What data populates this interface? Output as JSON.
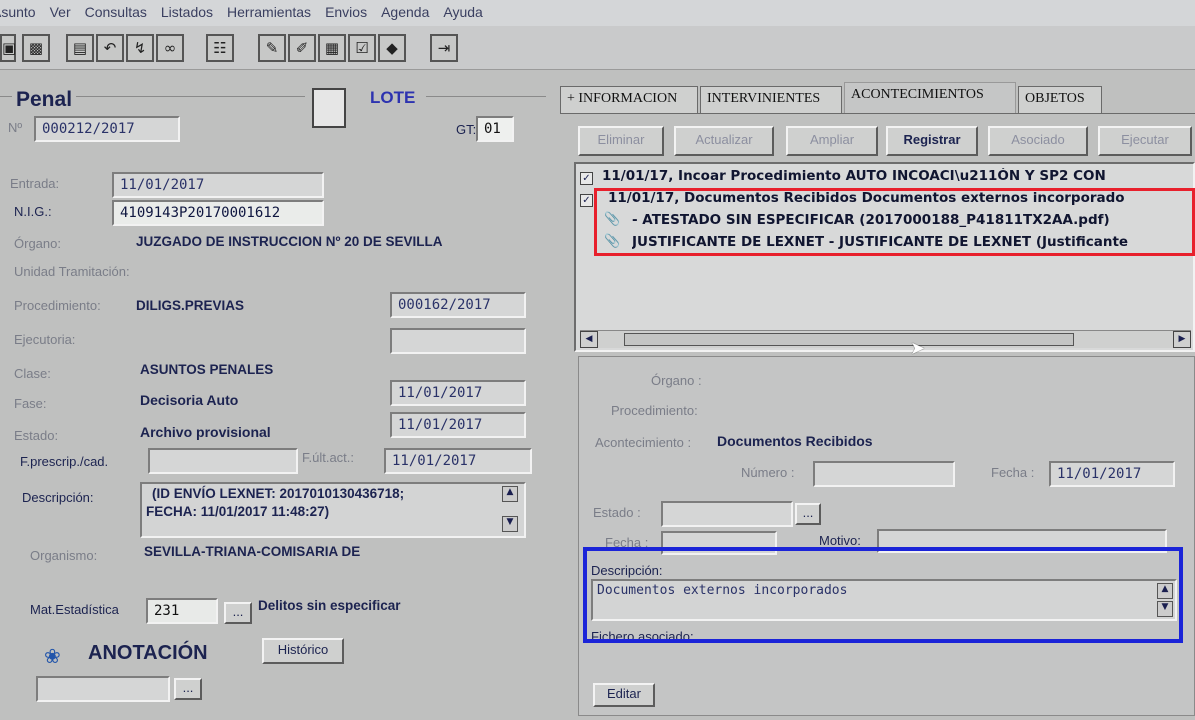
{
  "menu": [
    "Asunto",
    "Ver",
    "Consultas",
    "Listados",
    "Herramientas",
    "Envios",
    "Agenda",
    "Ayuda"
  ],
  "left": {
    "title": "Penal",
    "lote": "LOTE",
    "numero_label": "Nº",
    "numero": "000212/2017",
    "gt_label": "GT:",
    "gt": "01",
    "entrada_label": "Entrada:",
    "entrada": "11/01/2017",
    "nig_label": "N.I.G.:",
    "nig": "4109143P20170001612",
    "organo_label": "Órgano:",
    "organo": "JUZGADO DE INSTRUCCION Nº 20 DE SEVILLA",
    "unidad_label": "Unidad Tramitación:",
    "procedimiento_label": "Procedimiento:",
    "procedimiento": "DILIGS.PREVIAS",
    "procedimiento_num": "000162/2017",
    "ejecutoria_label": "Ejecutoria:",
    "clase_label": "Clase:",
    "clase": "ASUNTOS PENALES",
    "fase_label": "Fase:",
    "fase": "Decisoria Auto",
    "fase_fecha": "11/01/2017",
    "estado_label": "Estado:",
    "estado": "Archivo provisional",
    "estado_fecha": "11/01/2017",
    "fprescrip_label": "F.prescrip./cad.",
    "fultact_label": "F.últ.act.:",
    "fultact": "11/01/2017",
    "descripcion_label": "Descripción:",
    "descripcion_1": "(ID ENVÍO LEXNET: 2017010130436718;",
    "descripcion_2": "FECHA: 11/01/2017 11:48:27)",
    "organismo_label": "Organismo:",
    "organismo": "SEVILLA-TRIANA-COMISARIA DE",
    "matest_label": "Mat.Estadística",
    "matest": "231",
    "delitos": "Delitos sin especificar",
    "anotacion": "ANOTACIÓN",
    "historico": "Histórico",
    "ellipsis": "..."
  },
  "tabs": [
    "+ INFORMACION",
    "INTERVINIENTES",
    "ACONTECIMIENTOS",
    "OBJETOS"
  ],
  "actions": [
    "Eliminar",
    "Actualizar",
    "Ampliar",
    "Registrar",
    "Asociado",
    "Ejecutar"
  ],
  "events": [
    "11/01/17, Incoar Procedimiento AUTO INCOACI\\u211ÓN Y SP2 CON",
    "11/01/17, Documentos Recibidos Documentos externos incorporado",
    "- ATESTADO SIN ESPECIFICAR (2017000188_P41811TX2AA.pdf)",
    "JUSTIFICANTE DE LEXNET - JUSTIFICANTE DE LEXNET (Justificante"
  ],
  "detail": {
    "organo_label": "Órgano :",
    "procedimiento_label": "Procedimiento:",
    "acontecimiento_label": "Acontecimiento :",
    "acontecimiento": "Documentos Recibidos",
    "numero_label": "Número :",
    "fecha_label": "Fecha :",
    "fecha": "11/01/2017",
    "estado_label": "Estado :",
    "fecha2_label": "Fecha :",
    "motivo_label": "Motivo:",
    "descripcion_label": "Descripción:",
    "descripcion": "Documentos externos incorporados",
    "fichero_label": "Fichero asociado:",
    "editar": "Editar"
  },
  "colors": {
    "red_highlight": "#e8202c",
    "blue_highlight": "#1b24d8"
  }
}
